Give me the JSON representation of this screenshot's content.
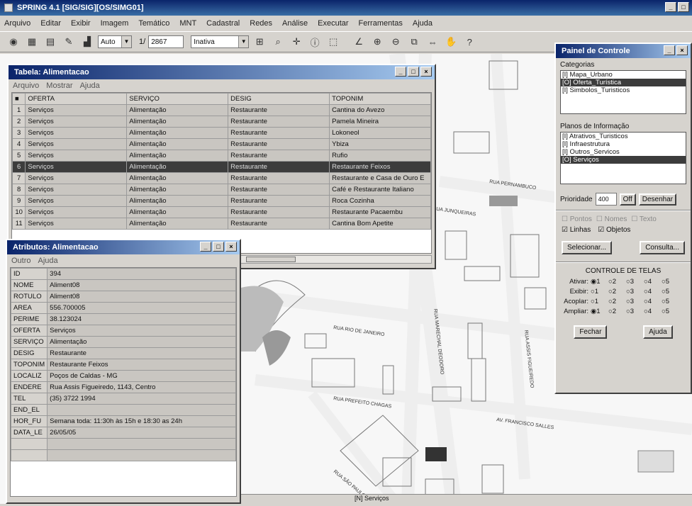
{
  "app": {
    "title": "SPRING 4.1 [SIG/SIG][OS/SIMG01]"
  },
  "menu": [
    "Arquivo",
    "Editar",
    "Exibir",
    "Imagem",
    "Temático",
    "MNT",
    "Cadastral",
    "Redes",
    "Análise",
    "Executar",
    "Ferramentas",
    "Ajuda"
  ],
  "toolbar": {
    "mode": "Auto",
    "scale_prefix": "1/",
    "scale_value": "2867",
    "view": "Inativa"
  },
  "table_window": {
    "title": "Tabela: Alimentacao",
    "menu": [
      "Arquivo",
      "Mostrar",
      "Ajuda"
    ],
    "columns": [
      "OFERTA",
      "SERVIÇO",
      "DESIG",
      "TOPONIM"
    ],
    "rows": [
      [
        "Serviços",
        "Alimentação",
        "Restaurante",
        "Cantina do Avezo"
      ],
      [
        "Serviços",
        "Alimentação",
        "Restaurante",
        "Pamela Mineira"
      ],
      [
        "Serviços",
        "Alimentação",
        "Restaurante",
        "Lokoneol"
      ],
      [
        "Serviços",
        "Alimentação",
        "Restaurante",
        "Ybiza"
      ],
      [
        "Serviços",
        "Alimentação",
        "Restaurante",
        "Rufio"
      ],
      [
        "Serviços",
        "Alimentação",
        "Restaurante",
        "Restaurante Feixos"
      ],
      [
        "Serviços",
        "Alimentação",
        "Restaurante",
        "Restaurante e Casa de Ouro E"
      ],
      [
        "Serviços",
        "Alimentação",
        "Restaurante",
        "Café e Restaurante Italiano"
      ],
      [
        "Serviços",
        "Alimentação",
        "Restaurante",
        "Roca Cozinha"
      ],
      [
        "Serviços",
        "Alimentação",
        "Restaurante",
        "Restaurante Pacaembu"
      ],
      [
        "Serviços",
        "Alimentação",
        "Restaurante",
        "Cantina Bom Apetite"
      ]
    ],
    "selected_row": 6
  },
  "attr_window": {
    "title": "Atributos: Alimentacao",
    "menu": [
      "Outro",
      "Ajuda"
    ],
    "rows": [
      [
        "ID",
        "394"
      ],
      [
        "NOME",
        "Aliment08"
      ],
      [
        "ROTULO",
        "Aliment08"
      ],
      [
        "AREA",
        "556.700005"
      ],
      [
        "PERIME",
        "38.123024"
      ],
      [
        "OFERTA",
        "Serviços"
      ],
      [
        "SERVIÇO",
        "Alimentação"
      ],
      [
        "DESIG",
        "Restaurante"
      ],
      [
        "TOPONIM",
        "Restaurante Feixos"
      ],
      [
        "LOCALIZ",
        "Poços de Caldas - MG"
      ],
      [
        "ENDERE",
        "Rua Assis Figueiredo, 1143, Centro"
      ],
      [
        "TEL",
        "(35) 3722 1994"
      ],
      [
        "END_EL",
        ""
      ],
      [
        "HOR_FU",
        "Semana toda: 11:30h às 15h e 18:30 as 24h"
      ],
      [
        "DATA_LE",
        "26/05/05"
      ],
      [
        "",
        ""
      ],
      [
        "",
        ""
      ]
    ]
  },
  "control_panel": {
    "title": "Painel de Controle",
    "categories_label": "Categorias",
    "categories": [
      "[I] Mapa_Urbano",
      "[O] Oferta_Turística",
      "[I] Simbolos_Turisticos"
    ],
    "categories_selected": 1,
    "info_label": "Planos de Informação",
    "info_planes": [
      "[I] Atrativos_Turisticos",
      "[I] Infraestrutura",
      "[I] Outros_Servicos",
      "[O] Serviços"
    ],
    "info_selected": 3,
    "priority_label": "Prioridade",
    "priority_value": "400",
    "off_label": "Off",
    "draw_button": "Desenhar",
    "check_points": "Pontos",
    "check_nodes": "Nomes",
    "check_text": "Texto",
    "check_lines": "Linhas",
    "check_objects": "Objetos",
    "select_button": "Selecionar...",
    "query_button": "Consulta...",
    "screens_title": "CONTROLE DE TELAS",
    "screen_rows": [
      "Ativar:",
      "Exibir:",
      "Acoplar:",
      "Ampliar:"
    ],
    "close_button": "Fechar",
    "help_button": "Ajuda"
  },
  "map": {
    "street_labels": [
      "RUA PERNAMBUCO",
      "RUA RIO DE JANEIRO",
      "RUA PREFEITO CHAGAS",
      "RUA JUNQUEIRAS",
      "AV. FRANCISCO SALLES",
      "RUA MARECHAL DEODORO",
      "RUA ASSIS FIGUEIREDO",
      "RUA SÃO PAULO"
    ],
    "status": "[N] Serviços"
  }
}
